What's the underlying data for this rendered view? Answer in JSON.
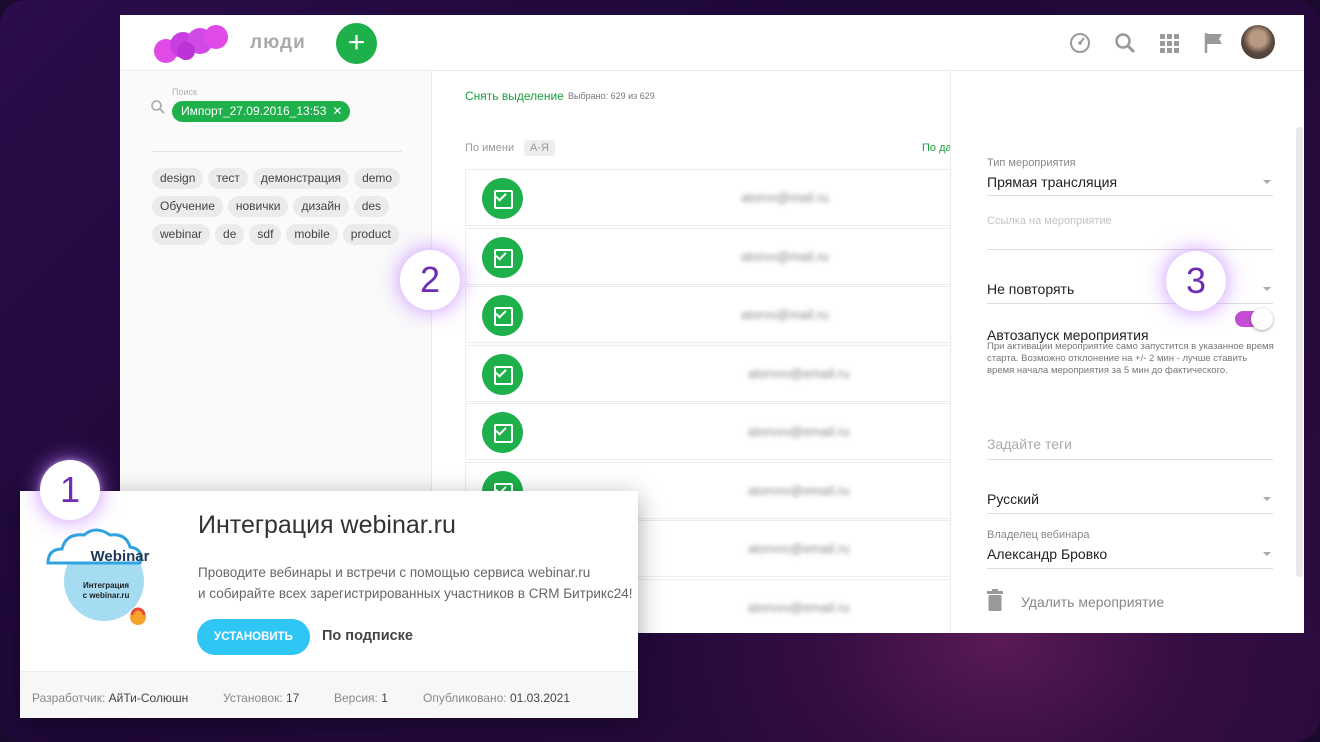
{
  "header": {
    "title": "люди",
    "add_label": "+"
  },
  "left_panel": {
    "search_label": "Поиск",
    "active_filter": "Импорт_27.09.2016_13:53",
    "filter_remove": "✕",
    "tags": [
      "design",
      "тест",
      "демонстрация",
      "demo",
      "Обучение",
      "новички",
      "дизайн",
      "des",
      "webinar",
      "de",
      "sdf",
      "mobile",
      "product"
    ]
  },
  "list": {
    "deselect_label": "Снять выделение",
    "selected_count": "Выбрано: 629 из 629",
    "sort_label": "По имени",
    "sort_order": "А-Я",
    "sort_right": "По да",
    "rows": [
      {
        "email": "atorvv@mail.ru"
      },
      {
        "email": "atorvv@mail.ru"
      },
      {
        "email": "atorvv@mail.ru"
      },
      {
        "email": "atorvvv@email.ru"
      },
      {
        "email": "atorvvv@email.ru"
      },
      {
        "email": "atorvvv@email.ru"
      },
      {
        "email": "atorvvv@email.ru"
      },
      {
        "email": "atorvvv@email.ru"
      }
    ]
  },
  "event_form": {
    "type_label": "Тип мероприятия",
    "type_value": "Прямая трансляция",
    "link_placeholder": "Ссылка на мероприятие",
    "repeat_value": "Не повторять",
    "autostart_label": "Автозапуск мероприятия",
    "autostart_on": true,
    "autostart_help": "При активации мероприятие само запустится в указанное время старта. Возможно отклонение на +/- 2 мин - лучше ставить время начала мероприятия за 5 мин до фактического.",
    "tags_placeholder": "Задайте теги",
    "language_value": "Русский",
    "owner_label": "Владелец вебинара",
    "owner_value": "Александр Бровко",
    "delete_label": "Удалить мероприятие"
  },
  "badges": {
    "one": "1",
    "two": "2",
    "three": "3"
  },
  "app_card": {
    "icon_word": "Webinar",
    "icon_caption_1": "Интеграция",
    "icon_caption_2": "с webinar.ru",
    "title": "Интеграция webinar.ru",
    "description_1": "Проводите вебинары и встречи с помощью сервиса webinar.ru",
    "description_2": "и собирайте всех зарегистрированных участников в CRM Битрикс24!",
    "install_label": "УСТАНОВИТЬ",
    "subscription_label": "По подписке",
    "developer_label": "Разработчик:",
    "developer_value": "АйТи-Солюшн",
    "installs_label": "Установок:",
    "installs_value": "17",
    "version_label": "Версия:",
    "version_value": "1",
    "published_label": "Опубликовано:",
    "published_value": "01.03.2021"
  },
  "colors": {
    "accent_green": "#1eb04b",
    "toggle": "#c44dd4",
    "install_blue": "#2fc6f6",
    "badge_text": "#6f2db2"
  }
}
